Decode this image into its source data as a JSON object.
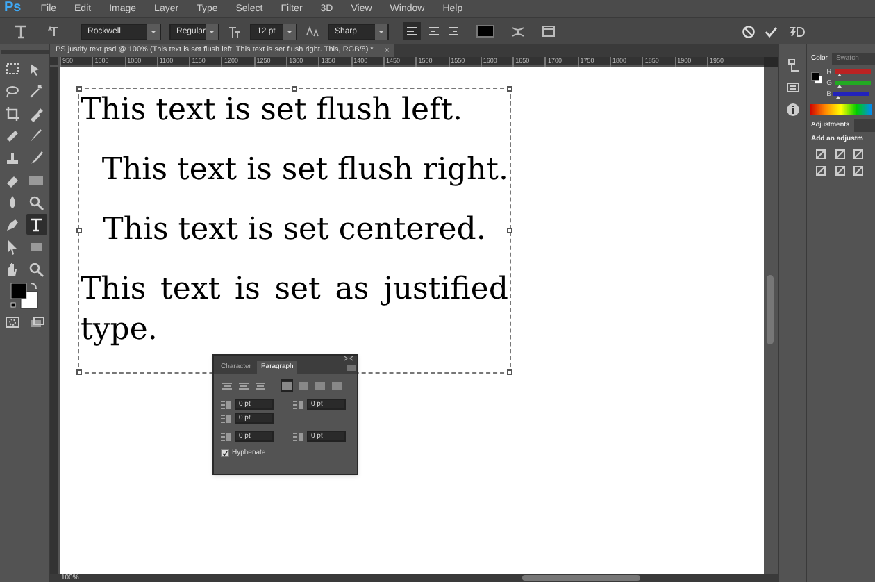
{
  "app_logo": "Ps",
  "menu": [
    "File",
    "Edit",
    "Image",
    "Layer",
    "Type",
    "Select",
    "Filter",
    "3D",
    "View",
    "Window",
    "Help"
  ],
  "options_bar": {
    "font_family": "Rockwell",
    "font_style": "Regular",
    "font_size": "12 pt",
    "antialias": "Sharp",
    "align": [
      {
        "selected": true
      },
      {
        "selected": false
      },
      {
        "selected": false
      }
    ]
  },
  "document_tab": {
    "title": "PS justify text.psd @ 100% (This text is set flush left. This text is set flush right. This, RGB/8) *",
    "close": "×"
  },
  "ruler": [
    "950",
    "1000",
    "1050",
    "1100",
    "1150",
    "1200",
    "1250",
    "1300",
    "1350",
    "1400",
    "1450",
    "1500",
    "1550",
    "1600",
    "1650",
    "1700",
    "1750",
    "1800",
    "1850",
    "1900",
    "1950"
  ],
  "tools": [
    {
      "selected": false
    },
    {
      "selected": false
    },
    {
      "selected": false
    },
    {
      "selected": false
    },
    {
      "selected": false
    },
    {
      "selected": false
    },
    {
      "selected": false
    },
    {
      "selected": false
    },
    {
      "selected": false
    },
    {
      "selected": false
    },
    {
      "selected": false
    },
    {
      "selected": false
    },
    {
      "selected": false
    },
    {
      "selected": false
    },
    {
      "selected": false
    },
    {
      "selected": true
    },
    {
      "selected": false
    },
    {
      "selected": false
    }
  ],
  "paragraphs": [
    {
      "text": "This text is set flush left.",
      "kind": "left"
    },
    {
      "text": "This text is set flush right.",
      "kind": "right"
    },
    {
      "text": "This text is set centered.",
      "kind": "center"
    },
    {
      "text": "This text is set as justified type.",
      "kind": "justify"
    }
  ],
  "paragraph_panel": {
    "tabs": [
      {
        "label": "Character",
        "selected": false
      },
      {
        "label": "Paragraph",
        "selected": true
      }
    ],
    "align": [
      {
        "selected": false
      },
      {
        "selected": false
      },
      {
        "selected": false
      },
      {
        "selected": true
      },
      {
        "selected": false
      },
      {
        "selected": false
      },
      {
        "selected": false
      }
    ],
    "fields": [
      "0 pt",
      "0 pt",
      "0 pt",
      "0 pt",
      "0 pt"
    ],
    "hyphenate": {
      "label": "Hyphenate",
      "checked": true
    }
  },
  "color_panel": {
    "tabs": [
      {
        "label": "Color",
        "selected": true
      },
      {
        "label": "Swatch",
        "selected": false
      }
    ],
    "channels": [
      "R",
      "G",
      "B"
    ]
  },
  "adjustments_panel": {
    "tab": "Adjustments",
    "hint": "Add an adjustm"
  },
  "status_bar": {
    "zoom": "100%"
  }
}
